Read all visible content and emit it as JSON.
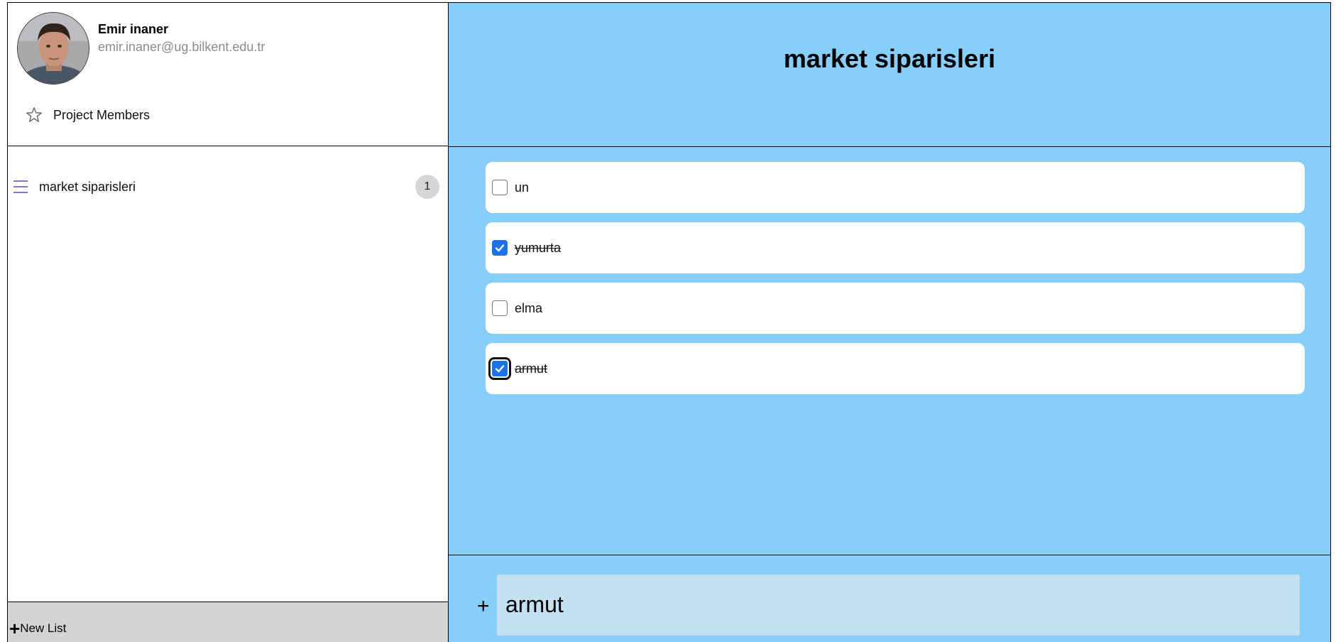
{
  "user": {
    "name": "Emir inaner",
    "email": "emir.inaner@ug.bilkent.edu.tr"
  },
  "sidebar": {
    "project_members_label": "Project Members",
    "lists": [
      {
        "name": "market siparisleri",
        "count": "1"
      }
    ],
    "new_list_label": "New List"
  },
  "main": {
    "title": "market siparisleri",
    "tasks": [
      {
        "label": "un",
        "done": false
      },
      {
        "label": "yumurta",
        "done": true
      },
      {
        "label": "elma",
        "done": false
      },
      {
        "label": "armut",
        "done": true
      }
    ],
    "add_input_value": "armut"
  },
  "colors": {
    "main_background": "#87cefa",
    "checkbox_checked": "#1a73e8",
    "list_icon": "#8c6fd6",
    "new_list_bar": "#d3d3d3",
    "input_background": "#c4e0f3"
  },
  "icons": {
    "star": "star-icon",
    "list": "menu-icon",
    "plus": "plus-icon",
    "check": "check-icon"
  }
}
